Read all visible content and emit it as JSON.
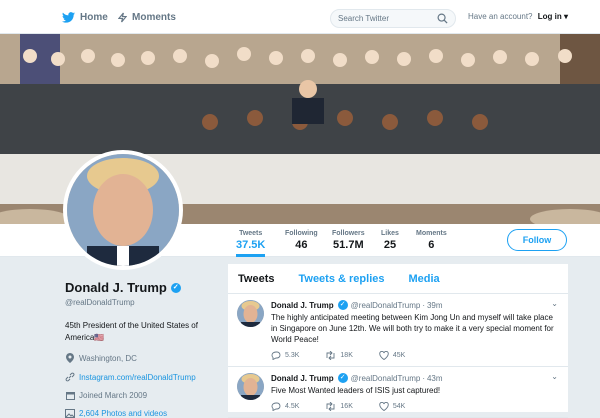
{
  "nav": {
    "home": "Home",
    "moments": "Moments",
    "search_placeholder": "Search Twitter",
    "account_prompt": "Have an account?",
    "login": "Log in ▾"
  },
  "profile": {
    "name": "Donald J. Trump",
    "handle": "@realDonaldTrump",
    "bio": "45th President of the United States of America🇺🇸",
    "location": "Washington, DC",
    "website": "Instagram.com/realDonaldTrump",
    "joined": "Joined March 2009",
    "media": "2,604 Photos and videos",
    "follow_label": "Follow"
  },
  "stats": [
    {
      "label": "Tweets",
      "value": "37.5K"
    },
    {
      "label": "Following",
      "value": "46"
    },
    {
      "label": "Followers",
      "value": "51.7M"
    },
    {
      "label": "Likes",
      "value": "25"
    },
    {
      "label": "Moments",
      "value": "6"
    }
  ],
  "tabs": [
    "Tweets",
    "Tweets & replies",
    "Media"
  ],
  "tweets": [
    {
      "name": "Donald J. Trump",
      "handle": "@realDonaldTrump",
      "time": "39m",
      "text": "The highly anticipated meeting between Kim Jong Un and myself will take place in Singapore on June 12th. We will both try to make it a very special moment for World Peace!",
      "replies": "5.3K",
      "retweets": "18K",
      "likes": "45K"
    },
    {
      "name": "Donald J. Trump",
      "handle": "@realDonaldTrump",
      "time": "43m",
      "text": "Five Most Wanted leaders of ISIS just captured!",
      "replies": "4.5K",
      "retweets": "16K",
      "likes": "54K"
    }
  ],
  "colors": {
    "accent": "#1da1f2",
    "text": "#14171a",
    "muted": "#657786",
    "background": "#e6ecf0"
  }
}
